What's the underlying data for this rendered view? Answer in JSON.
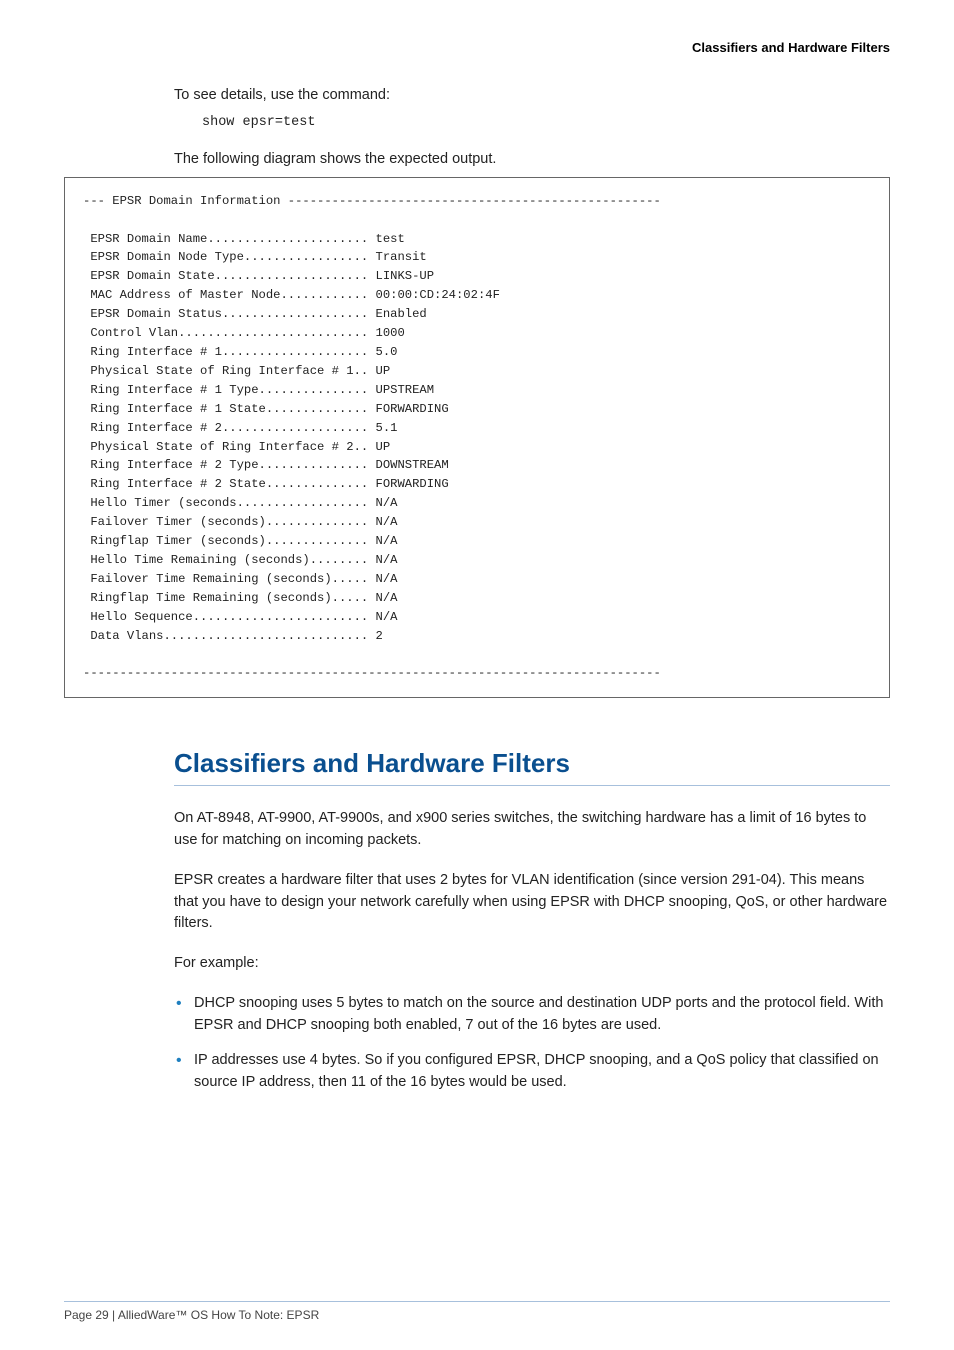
{
  "header": {
    "title_right": "Classifiers and Hardware Filters"
  },
  "intro": {
    "line1": "To see details, use the command:",
    "command": "show epsr=test",
    "line2": "The following diagram shows the expected output."
  },
  "codebox": "--- EPSR Domain Information ---------------------------------------------------\n\n EPSR Domain Name...................... test\n EPSR Domain Node Type................. Transit\n EPSR Domain State..................... LINKS-UP\n MAC Address of Master Node............ 00:00:CD:24:02:4F\n EPSR Domain Status.................... Enabled\n Control Vlan.......................... 1000\n Ring Interface # 1.................... 5.0\n Physical State of Ring Interface # 1.. UP\n Ring Interface # 1 Type............... UPSTREAM\n Ring Interface # 1 State.............. FORWARDING\n Ring Interface # 2.................... 5.1\n Physical State of Ring Interface # 2.. UP\n Ring Interface # 2 Type............... DOWNSTREAM\n Ring Interface # 2 State.............. FORWARDING\n Hello Timer (seconds.................. N/A\n Failover Timer (seconds).............. N/A\n Ringflap Timer (seconds).............. N/A\n Hello Time Remaining (seconds)........ N/A\n Failover Time Remaining (seconds)..... N/A\n Ringflap Time Remaining (seconds)..... N/A\n Hello Sequence........................ N/A\n Data Vlans............................ 2\n\n-------------------------------------------------------------------------------",
  "section": {
    "title": "Classifiers and Hardware Filters",
    "p1": "On AT-8948, AT-9900, AT-9900s, and x900 series switches, the switching hardware has a limit of 16 bytes to use for matching on incoming packets.",
    "p2": "EPSR creates a hardware filter that uses 2 bytes for VLAN identification (since version 291-04). This means that you have to design your network carefully when using EPSR with DHCP snooping, QoS, or other hardware filters.",
    "p3": "For example:",
    "bullets": [
      "DHCP snooping uses 5 bytes to match on the source and destination UDP ports and the protocol field. With EPSR and DHCP snooping both enabled, 7 out of the 16 bytes are used.",
      "IP addresses use 4 bytes. So if you configured EPSR, DHCP snooping, and a QoS policy that classified on source IP address, then 11 of the 16 bytes would be used."
    ]
  },
  "footer": {
    "text": "Page 29 | AlliedWare™ OS How To Note: EPSR"
  }
}
